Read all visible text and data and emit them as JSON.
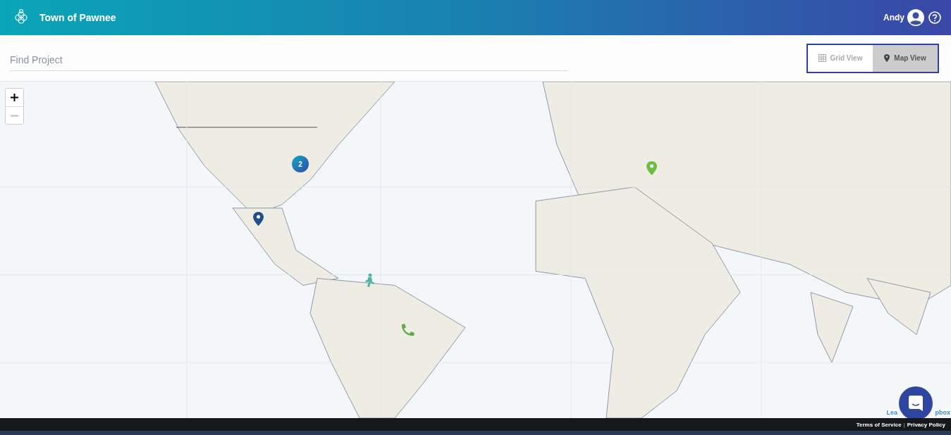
{
  "header": {
    "title": "Town of Pawnee",
    "user": "Andy"
  },
  "search": {
    "placeholder": "Find Project"
  },
  "view_toggle": [
    {
      "label": "Grid View",
      "kind": "grid",
      "selected": false
    },
    {
      "label": "Map View",
      "kind": "map",
      "selected": true
    }
  ],
  "map": {
    "markers": [
      {
        "kind": "cluster",
        "count": "2"
      },
      {
        "kind": "pin",
        "color": "#1f4e8c"
      },
      {
        "kind": "figure",
        "color": "#4fb3a0"
      },
      {
        "kind": "phone",
        "color": "#5aae45"
      },
      {
        "kind": "pin",
        "color": "#6cbf3c"
      }
    ],
    "attribution": [
      "Lea",
      "pbox"
    ]
  },
  "footer": {
    "links": [
      "Terms of Service",
      "Privacy Policy"
    ],
    "separator": "|"
  }
}
